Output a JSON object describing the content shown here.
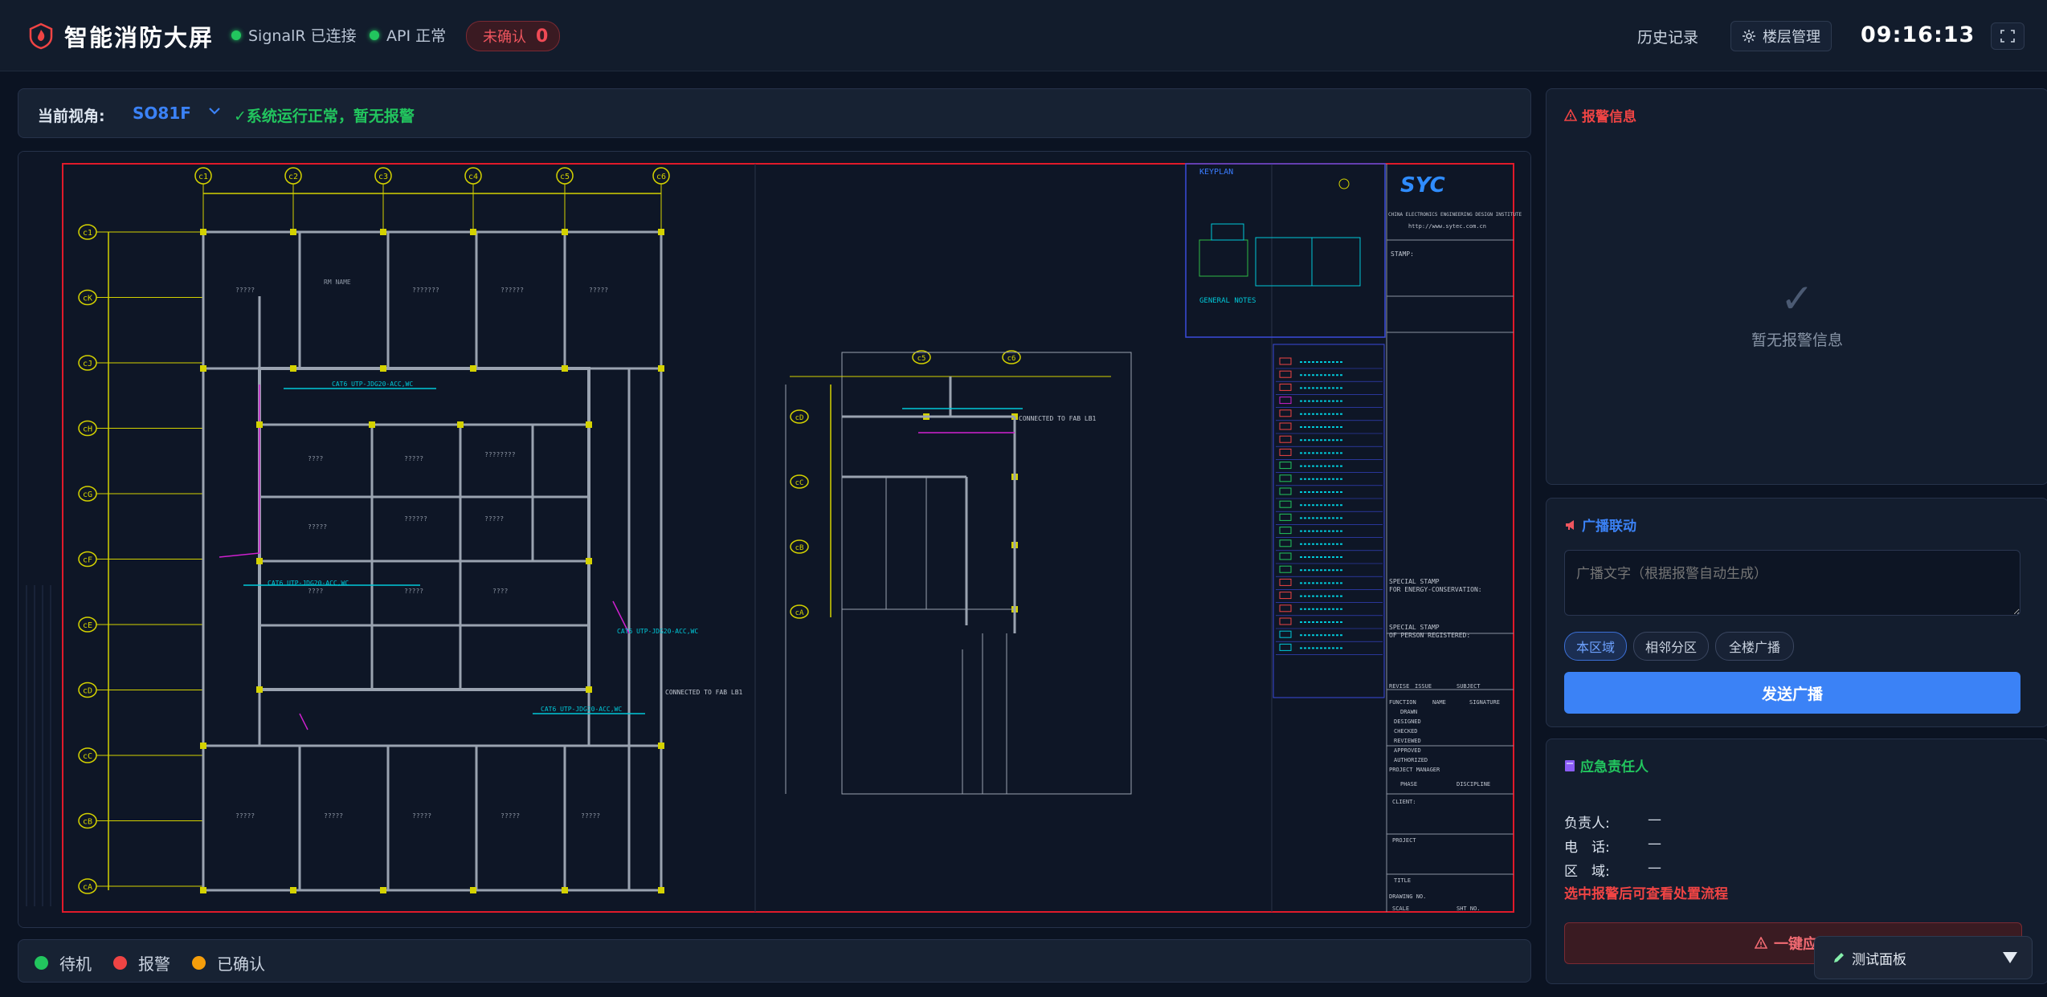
{
  "header": {
    "title": "智能消防大屏",
    "signalr_status": "SignalR 已连接",
    "api_status": "API 正常",
    "unconfirmed_label": "未确认",
    "unconfirmed_count": "0",
    "history_link": "历史记录",
    "layer_button": "楼层管理",
    "clock": "09:16:13",
    "status_color": "#22c55e",
    "accent_color": "#3b82f6"
  },
  "viewbar": {
    "label": "当前视角:",
    "value": "SO81F",
    "status": "✓系统运行正常，暂无报警"
  },
  "drawing": {
    "keyplan": "KEYPLAN",
    "general_notes": "GENERAL NOTES",
    "url": "http://www.sytec.com.cn",
    "stamp": "STAMP:",
    "special_stamp_1": "SPECIAL STAMP",
    "special_stamp_1b": "FOR ENERGY-CONSERVATION:",
    "special_stamp_2": "SPECIAL STAMP",
    "special_stamp_2b": "OF PERSON REGISTERED:",
    "col_grid_top": [
      "c1",
      "c2",
      "c3",
      "c4",
      "c5",
      "c6"
    ],
    "row_grid_left": [
      "c1",
      "cK",
      "cJ",
      "cH",
      "cG",
      "cF",
      "cE",
      "cD",
      "cC",
      "cB",
      "cA"
    ],
    "col_grid_right": [
      "c5",
      "c6"
    ],
    "row_grid_right": [
      "cD",
      "cC",
      "cB",
      "cA"
    ],
    "title_block": [
      "REVISE",
      "ISSUE",
      "SUBJECT",
      "FUNCTION",
      "NAME",
      "SIGNATURE",
      "DRAWN",
      "DESIGNED",
      "CHECKED",
      "REVIEWED",
      "APPROVED",
      "AUTHORIZED",
      "PROJECT MANAGER",
      "PHASE",
      "DISCIPLINE",
      "CLIENT:",
      "PROJECT",
      "TITLE",
      "DRAWING NO.",
      "SCALE",
      "SHT NO."
    ],
    "cable_label": "CAT6 UTP-JDG20-ACC,WC",
    "connect_label": "CONNECTED TO FAB LB1"
  },
  "legend": [
    {
      "label": "待机",
      "color": "#22c55e"
    },
    {
      "label": "报警",
      "color": "#ef4444"
    },
    {
      "label": "已确认",
      "color": "#f59e0b"
    }
  ],
  "alarm_panel": {
    "title": "报警信息",
    "empty_check": "✓",
    "empty_text": "暂无报警信息",
    "title_color": "#ef4444"
  },
  "broadcast_panel": {
    "title": "广播联动",
    "placeholder": "广播文字（根据报警自动生成）",
    "chips": [
      "本区域",
      "相邻分区",
      "全楼广播"
    ],
    "send_button": "发送广播",
    "title_color": "#3b82f6"
  },
  "contact_panel": {
    "title": "应急责任人",
    "rows": [
      {
        "key": "负责人:",
        "value": "—"
      },
      {
        "key": "电　话:",
        "value": "—"
      },
      {
        "key": "区　域:",
        "value": "—"
      }
    ],
    "hint": "选中报警后可查看处置流程",
    "emergency_button": "一键应急",
    "title_color": "#22c55e"
  },
  "test_panel": {
    "label": "测试面板"
  }
}
